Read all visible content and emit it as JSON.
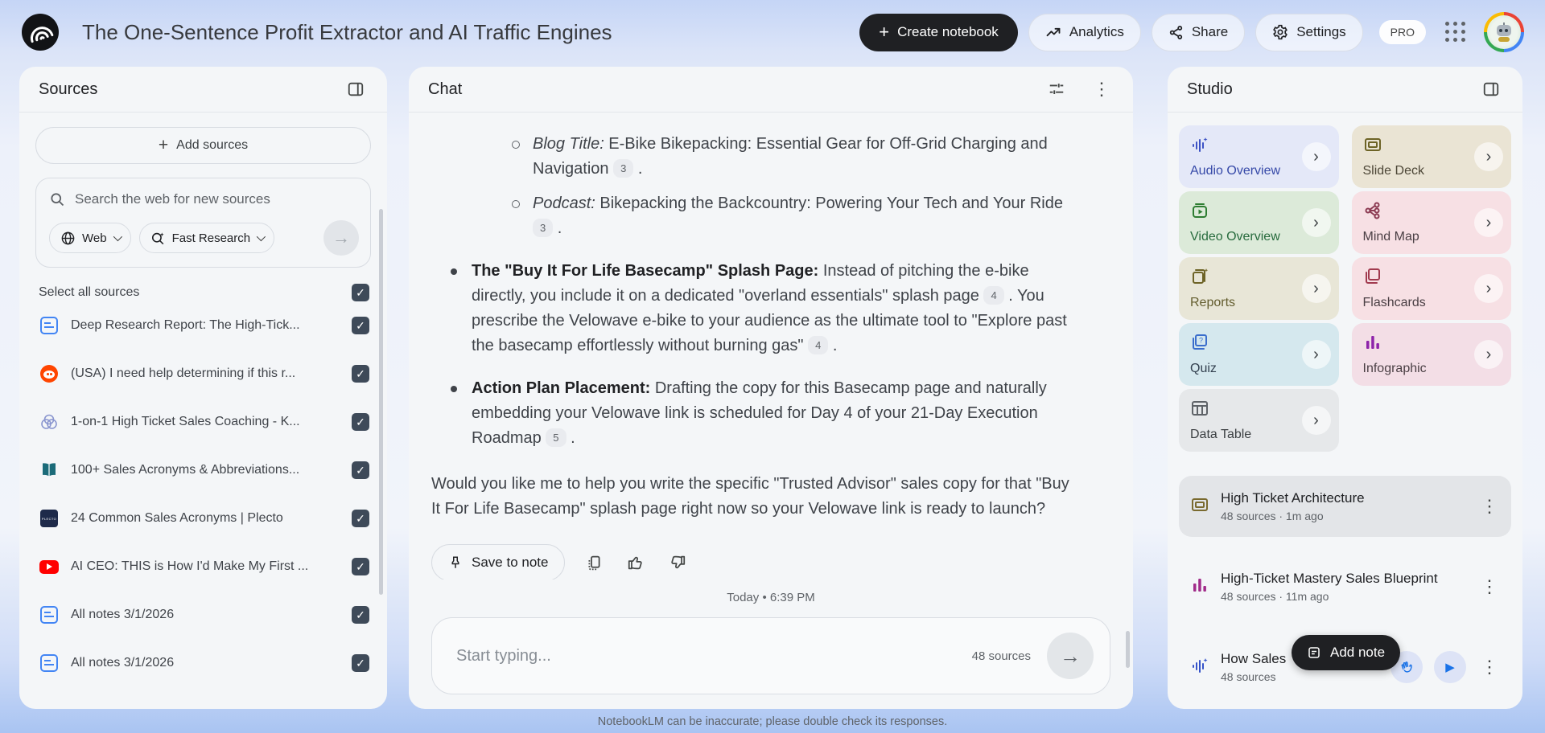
{
  "header": {
    "title": "The One-Sentence Profit Extractor and AI Traffic Engines",
    "create_notebook_label": "Create notebook",
    "analytics_label": "Analytics",
    "share_label": "Share",
    "settings_label": "Settings",
    "pro_badge": "PRO"
  },
  "sources": {
    "title": "Sources",
    "add_sources_label": "Add sources",
    "search_placeholder": "Search the web for new sources",
    "web_chip_label": "Web",
    "research_chip_label": "Fast Research",
    "select_all_label": "Select all sources",
    "items": [
      {
        "icon": "doc",
        "title": "Deep Research Report: The High-Tick...",
        "checked": true
      },
      {
        "icon": "reddit",
        "title": "(USA) I need help determining if this r...",
        "checked": true
      },
      {
        "icon": "venn",
        "title": "1-on-1 High Ticket Sales Coaching - K...",
        "checked": true
      },
      {
        "icon": "book",
        "title": "100+ Sales Acronyms & Abbreviations...",
        "checked": true
      },
      {
        "icon": "plecto",
        "title": "24 Common Sales Acronyms | Plecto",
        "checked": true
      },
      {
        "icon": "youtube",
        "title": "AI CEO: THIS is How I'd Make My First ...",
        "checked": true
      },
      {
        "icon": "doc",
        "title": "All notes 3/1/2026",
        "checked": true
      },
      {
        "icon": "doc",
        "title": "All notes 3/1/2026",
        "checked": true
      }
    ]
  },
  "chat": {
    "title": "Chat",
    "sub_bullets": [
      {
        "lead": "Blog Title:",
        "segments": [
          {
            "t": " E-Bike Bikepacking: Essential Gear for Off-Grid Charging and Navigation "
          },
          {
            "c": "3"
          },
          {
            "t": " ."
          }
        ]
      },
      {
        "lead": "Podcast:",
        "segments": [
          {
            "t": " Bikepacking the Backcountry: Powering Your Tech and Your Ride "
          },
          {
            "c": "3"
          },
          {
            "t": " ."
          }
        ]
      }
    ],
    "bullets": [
      {
        "lead": "The \"Buy It For Life Basecamp\" Splash Page:",
        "segments": [
          {
            "t": " Instead of pitching the e-bike directly, you include it on a dedicated \"overland essentials\" splash page "
          },
          {
            "c": "4"
          },
          {
            "t": " . You prescribe the Velowave e-bike to your audience as the ultimate tool to \"Explore past the basecamp effortlessly without burning gas\" "
          },
          {
            "c": "4"
          },
          {
            "t": " ."
          }
        ]
      },
      {
        "lead": "Action Plan Placement:",
        "segments": [
          {
            "t": " Drafting the copy for this Basecamp page and naturally embedding your Velowave link is scheduled for Day 4 of your 21-Day Execution Roadmap "
          },
          {
            "c": "5"
          },
          {
            "t": " ."
          }
        ]
      }
    ],
    "closing": "Would you like me to help you write the specific \"Trusted Advisor\" sales copy for that \"Buy It For Life Basecamp\" splash page right now so your Velowave link is ready to launch?",
    "save_to_note_label": "Save to note",
    "date_divider": "Today • 6:39 PM",
    "input_placeholder": "Start typing...",
    "sources_count": "48 sources",
    "disclaimer": "NotebookLM can be inaccurate; please double check its responses."
  },
  "studio": {
    "title": "Studio",
    "tiles": [
      {
        "label": "Audio Overview",
        "icon": "audio",
        "bg": "#e4e8f8",
        "fg": "#3649a8",
        "icon_color": "#3d52c5"
      },
      {
        "label": "Slide Deck",
        "icon": "slides",
        "bg": "#eae4d4",
        "fg": "#4c4636",
        "icon_color": "#6d6326"
      },
      {
        "label": "Video Overview",
        "icon": "video",
        "bg": "#dcead9",
        "fg": "#276b3d",
        "icon_color": "#2e7d32"
      },
      {
        "label": "Mind Map",
        "icon": "mindmap",
        "bg": "#f7e0e4",
        "fg": "#4a3f44",
        "icon_color": "#8c3b52"
      },
      {
        "label": "Reports",
        "icon": "reports",
        "bg": "#e8e6d7",
        "fg": "#635d2e",
        "icon_color": "#6d6326"
      },
      {
        "label": "Flashcards",
        "icon": "flashcards",
        "bg": "#f7e0e4",
        "fg": "#4a3f44",
        "icon_color": "#a13a4e"
      },
      {
        "label": "Quiz",
        "icon": "quiz",
        "bg": "#d5e8ee",
        "fg": "#33404f",
        "icon_color": "#3b6ecc"
      },
      {
        "label": "Infographic",
        "icon": "infographic",
        "bg": "#f3dee6",
        "fg": "#4a3f44",
        "icon_color": "#8e24aa"
      },
      {
        "label": "Data Table",
        "icon": "table",
        "bg": "#e6e8ea",
        "fg": "#3c4043",
        "icon_color": "#5f6368"
      }
    ],
    "notes": [
      {
        "icon": "slides",
        "icon_color": "#7a6a2f",
        "title": "High Ticket Architecture",
        "meta": "48 sources · 1m ago",
        "selected": true,
        "controls": false
      },
      {
        "icon": "infographic",
        "icon_color": "#a12c8a",
        "title": "High-Ticket Mastery Sales Blueprint",
        "meta": "48 sources · 11m ago",
        "selected": false,
        "controls": false
      },
      {
        "icon": "audio",
        "icon_color": "#3553c9",
        "title": "How Sales",
        "meta": "48 sources",
        "selected": false,
        "controls": true
      }
    ],
    "add_note_label": "Add note"
  }
}
